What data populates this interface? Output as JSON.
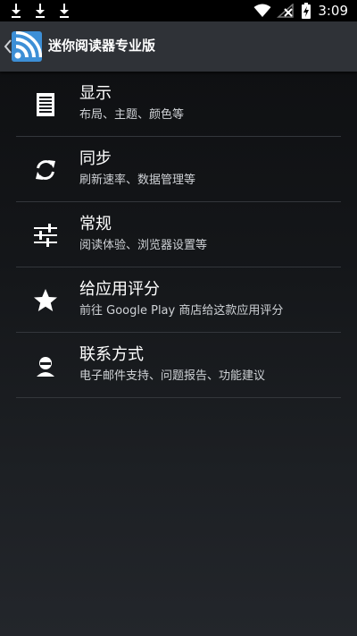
{
  "status_bar": {
    "time": "3:09",
    "icons": [
      "download-icon",
      "download-icon",
      "download-icon",
      "wifi-icon",
      "signal-off-icon",
      "battery-charging-icon"
    ]
  },
  "toolbar": {
    "title": "迷你阅读器专业版",
    "logo_icon": "rss-feed-icon",
    "back_icon": "chevron-left-icon"
  },
  "menu": {
    "items": [
      {
        "label": "显示",
        "sub": "布局、主题、颜色等",
        "icon": "document-icon"
      },
      {
        "label": "同步",
        "sub": "刷新速率、数据管理等",
        "icon": "sync-icon"
      },
      {
        "label": "常规",
        "sub": "阅读体验、浏览器设置等",
        "icon": "sliders-icon"
      },
      {
        "label": "给应用评分",
        "sub": "前往 Google Play 商店给这款应用评分",
        "icon": "star-icon"
      },
      {
        "label": "联系方式",
        "sub": "电子邮件支持、问题报告、功能建议",
        "icon": "contact-icon"
      }
    ]
  },
  "colors": {
    "toolbar_bg": "#2f3237",
    "logo_blue": "#3d8fd6",
    "divider": "#33363b"
  }
}
